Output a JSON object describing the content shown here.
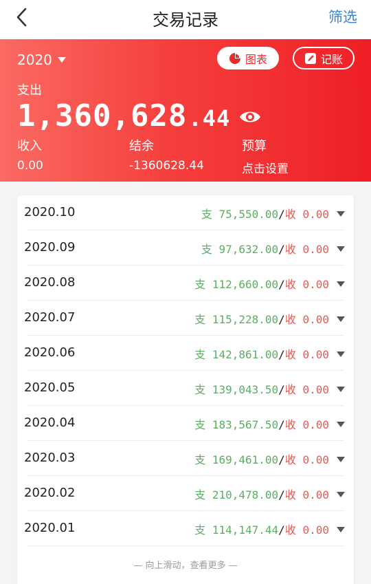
{
  "nav": {
    "title": "交易记录",
    "filter_label": "筛选"
  },
  "header": {
    "year": "2020",
    "chart_button": "图表",
    "book_button": "记账",
    "expense_label": "支出",
    "expense_amount_int": "1,360,628",
    "expense_amount_dec": ".44",
    "income_label": "收入",
    "income_value": "0.00",
    "balance_label": "结余",
    "balance_value": "-1360628.44",
    "budget_label": "预算",
    "budget_value": "点击设置"
  },
  "months": [
    {
      "date": "2020.10",
      "exp_prefix": "支",
      "expense": "75,550.00",
      "inc_prefix": "收",
      "income": "0.00"
    },
    {
      "date": "2020.09",
      "exp_prefix": "支",
      "expense": "97,632.00",
      "inc_prefix": "收",
      "income": "0.00"
    },
    {
      "date": "2020.08",
      "exp_prefix": "支",
      "expense": "112,660.00",
      "inc_prefix": "收",
      "income": "0.00"
    },
    {
      "date": "2020.07",
      "exp_prefix": "支",
      "expense": "115,228.00",
      "inc_prefix": "收",
      "income": "0.00"
    },
    {
      "date": "2020.06",
      "exp_prefix": "支",
      "expense": "142,861.00",
      "inc_prefix": "收",
      "income": "0.00"
    },
    {
      "date": "2020.05",
      "exp_prefix": "支",
      "expense": "139,043.50",
      "inc_prefix": "收",
      "income": "0.00"
    },
    {
      "date": "2020.04",
      "exp_prefix": "支",
      "expense": "183,567.50",
      "inc_prefix": "收",
      "income": "0.00"
    },
    {
      "date": "2020.03",
      "exp_prefix": "支",
      "expense": "169,461.00",
      "inc_prefix": "收",
      "income": "0.00"
    },
    {
      "date": "2020.02",
      "exp_prefix": "支",
      "expense": "210,478.00",
      "inc_prefix": "收",
      "income": "0.00"
    },
    {
      "date": "2020.01",
      "exp_prefix": "支",
      "expense": "114,147.44",
      "inc_prefix": "收",
      "income": "0.00"
    }
  ],
  "footer_hint": "— 向上滑动，查看更多 —",
  "colors": {
    "accent_red": "#ee1f25",
    "expense_green": "#5cae62",
    "income_red": "#e45b56",
    "link_blue": "#3f86c9"
  }
}
